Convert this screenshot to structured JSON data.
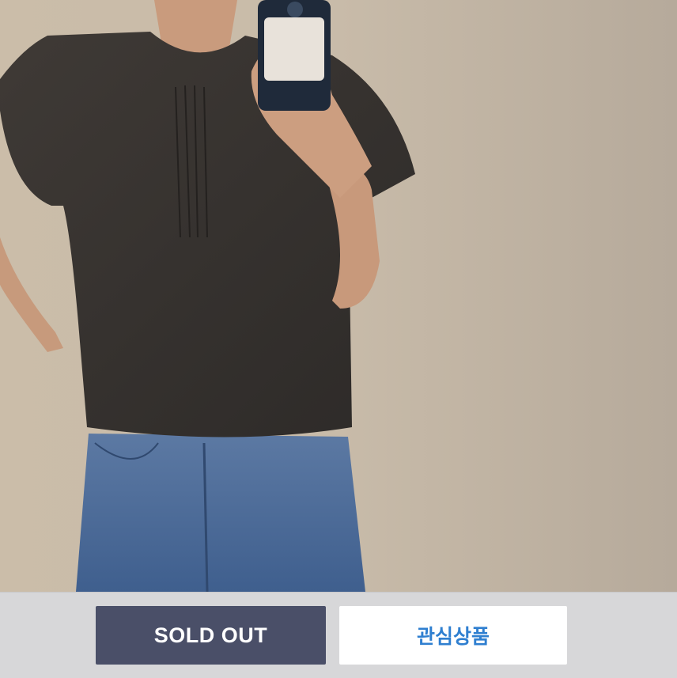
{
  "product_image": {
    "icon": "product-photo-blouse"
  },
  "actions": {
    "sold_out_label": "SOLD OUT",
    "wishlist_label": "관심상품"
  },
  "colors": {
    "sold_out_bg": "#4a4f68",
    "wishlist_text": "#2f7fd0",
    "bar_bg": "#d7d7d9"
  }
}
